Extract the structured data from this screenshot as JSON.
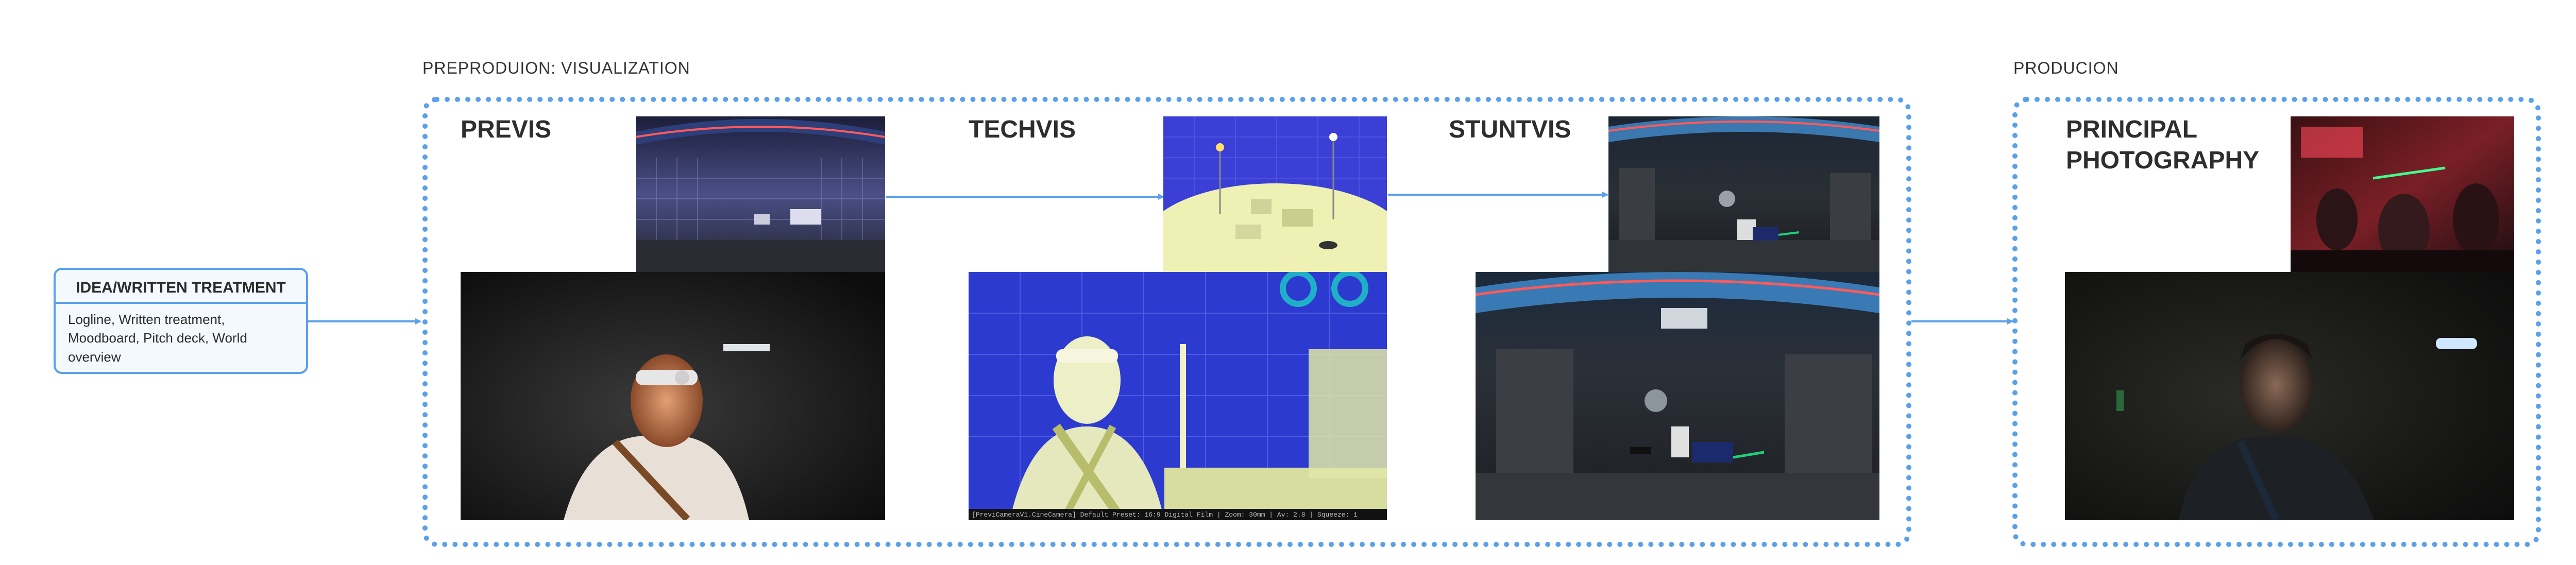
{
  "section_labels": {
    "previz_group": "PREPRODUION: VISUALIZATION",
    "production_group": "PRODUCION"
  },
  "idea": {
    "title": "IDEA/WRITTEN TREATMENT",
    "body": "Logline, Written treatment, Moodboard, Pitch deck, World overview"
  },
  "stages": {
    "previs": "PREVIS",
    "techvis": "TECHVIS",
    "stuntvis": "STUNTVIS",
    "principal": "PRINCIPAL PHOTOGRAPHY"
  },
  "techvis_caption": "[PreviCameraV1.CineCamera] Default Preset: 16:9 Digital Film | Zoom: 30mm | Av: 2.8 | Squeeze: 1",
  "colors": {
    "accent": "#5aa0ea",
    "text": "#2e2e2e"
  }
}
